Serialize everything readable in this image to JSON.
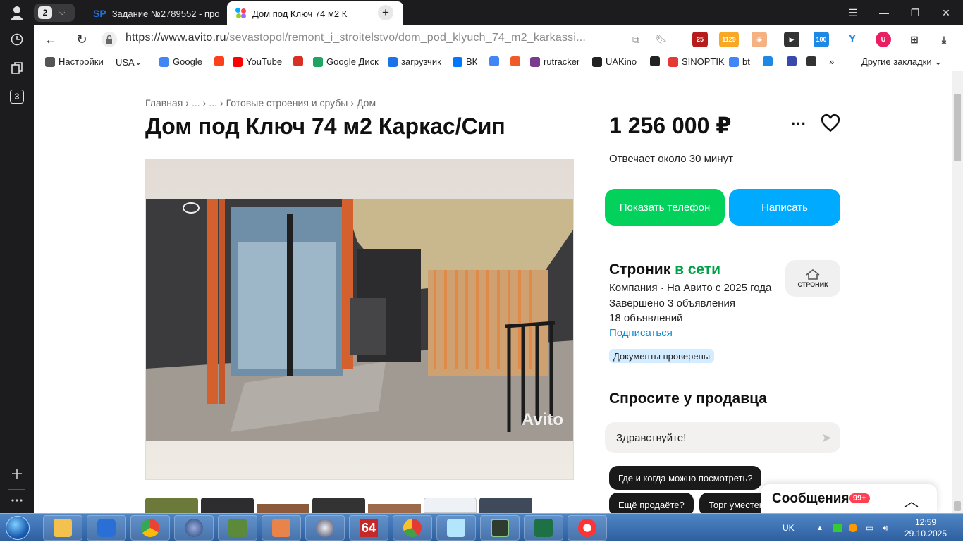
{
  "browser": {
    "tab_count": "2",
    "tabs": [
      {
        "label": "Задание №2789552 - про",
        "favicon": "SP"
      },
      {
        "label": "Дом под Ключ 74 м2 К",
        "favicon": "avito"
      }
    ],
    "url_host": "https://www.avito.ru",
    "url_path": "/sevastopol/remont_i_stroitelstvo/dom_pod_klyuch_74_m2_karkassi...",
    "sidebar_badge": "3"
  },
  "bookmarks": [
    {
      "label": "Настройки",
      "icon": "gear-icon",
      "color": "#555555"
    },
    {
      "label": "USA",
      "icon": "dropdown",
      "color": "#555555"
    },
    {
      "label": "Google",
      "icon": "google-icon",
      "color": "#4285f4"
    },
    {
      "label": "",
      "icon": "yandex-icon",
      "color": "#fc3f1d"
    },
    {
      "label": "YouTube",
      "icon": "youtube-icon",
      "color": "#ff0000"
    },
    {
      "label": "",
      "icon": "gmail-icon",
      "color": "#d93025"
    },
    {
      "label": "Google Диск",
      "icon": "drive-icon",
      "color": "#1fa463"
    },
    {
      "label": "загрузчик",
      "icon": "infinity-icon",
      "color": "#1a73e8"
    },
    {
      "label": "ВК",
      "icon": "vk-icon",
      "color": "#0077ff"
    },
    {
      "label": "",
      "icon": "translate-icon",
      "color": "#4285f4"
    },
    {
      "label": "",
      "icon": "f-icon",
      "color": "#f05a28"
    },
    {
      "label": "rutracker",
      "icon": "rutracker-icon",
      "color": "#7a3b8f"
    },
    {
      "label": "UAKino",
      "icon": "uakino-icon",
      "color": "#222222"
    },
    {
      "label": "",
      "icon": "chess-icon",
      "color": "#222222"
    },
    {
      "label": "SINOPTIK",
      "icon": "thermometer-icon",
      "color": "#e53935"
    },
    {
      "label": "bt",
      "icon": "google-icon",
      "color": "#4285f4"
    },
    {
      "label": "",
      "icon": "p-icon",
      "color": "#1e88e5"
    },
    {
      "label": "",
      "icon": "chevron-icon",
      "color": "#3949ab"
    },
    {
      "label": "",
      "icon": "bc-icon",
      "color": "#333333"
    },
    {
      "label": "»",
      "icon": "more-icon",
      "color": "#333333"
    }
  ],
  "other_bookmarks": "Другие закладки",
  "listing": {
    "breadcrumbs": [
      "Главная",
      "...",
      "...",
      "Готовые строения и срубы",
      "Дом"
    ],
    "title": "Дом под Ключ 74 м2 Каркас/Сип",
    "watermark": "Avito",
    "price": "1 256 000 ₽",
    "reply_time": "Отвечает около 30 минут",
    "show_phone": "Показать телефон",
    "write": "Написать"
  },
  "seller": {
    "name": "Строник",
    "status": "в сети",
    "line1": "Компания · На Авито с 2025 года",
    "line2": "Завершено 3 объявления",
    "line3": "18 объявлений",
    "subscribe": "Подписаться",
    "docs": "Документы проверены",
    "logo_text": "СТРОНИК"
  },
  "ask": {
    "title": "Спросите у продавца",
    "input_value": "Здравствуйте!",
    "chips": [
      "Где и когда можно посмотреть?",
      "Ещё продаёте?",
      "Торг уместен?"
    ]
  },
  "messages": {
    "label": "Сообщения",
    "count": "99+"
  },
  "taskbar": {
    "lang": "UK",
    "time": "12:59",
    "date": "29.10.2025",
    "app_icons": [
      "explorer-icon",
      "security-icon",
      "chrome-icon",
      "network-icon",
      "calc-icon",
      "media-icon",
      "clock-icon",
      "aida64-icon",
      "chart-icon",
      "notepad-icon",
      "terminal-icon",
      "excel-icon",
      "yandex-browser-icon"
    ],
    "app_label_aida": "64"
  }
}
